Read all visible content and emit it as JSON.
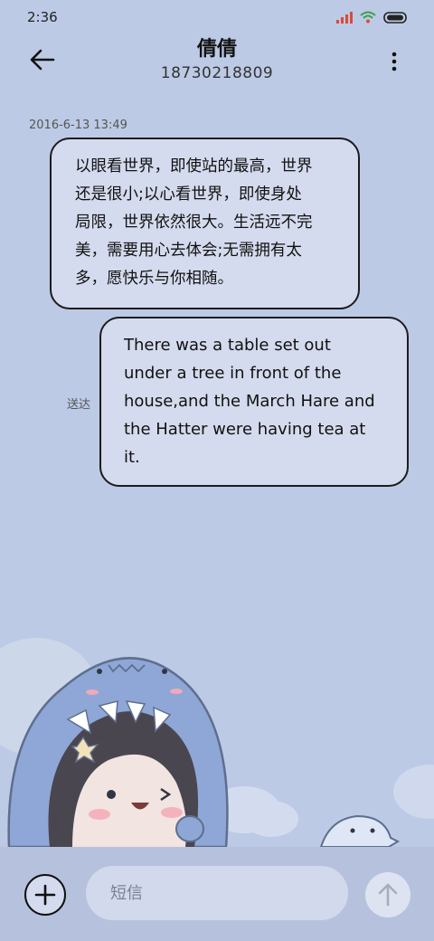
{
  "status_bar": {
    "time": "2:36"
  },
  "header": {
    "title": "倩倩",
    "phone": "18730218809"
  },
  "conversation": {
    "timestamp": "2016-6-13 13:49",
    "incoming": {
      "lines": [
        "以眼看世界，即使站的最高，世界",
        "还是很小;以心看世界，即使身处",
        "局限，世界依然很大。生活远不完",
        "美，需要用心去体会;无需拥有太",
        "多，愿快乐与你相随。"
      ]
    },
    "outgoing": {
      "status": "送达",
      "lines": [
        "There was a table set out",
        "under a tree in front of the",
        "house,and the March Hare and",
        "the Hatter were having tea at",
        "it."
      ]
    }
  },
  "composer": {
    "placeholder": "短信"
  },
  "colors": {
    "background": "#bccae5",
    "bubble": "#d5dbee",
    "bubble_border": "#1c1c1c",
    "accent": "#3b6bd9"
  }
}
